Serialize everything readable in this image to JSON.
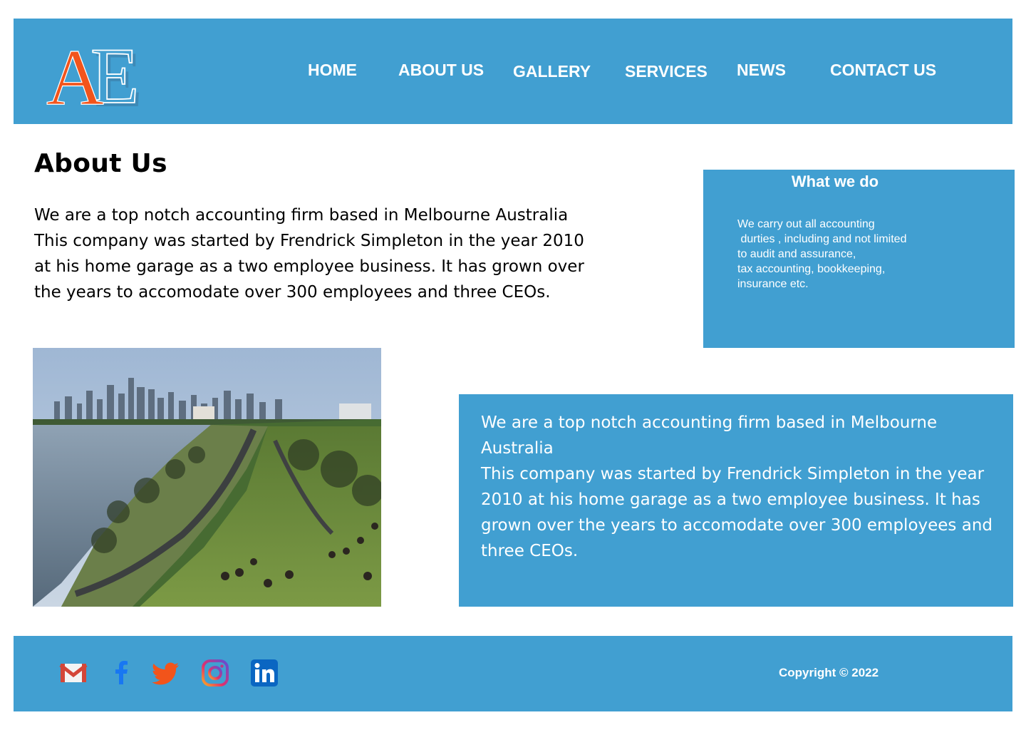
{
  "header": {
    "logo_text": "AE",
    "nav": [
      "HOME",
      "ABOUT US",
      "GALLERY",
      "SERVICES",
      "NEWS",
      "CONTACT US"
    ]
  },
  "about": {
    "title": "About Us",
    "paragraph_lines": [
      "We are a top notch accounting firm based in Melbourne Australia",
      "This company was started by Frendrick Simpleton in the year 2010 at his home garage as a two employee business. It has grown over the years to accomodate over 300 employees and three CEOs."
    ]
  },
  "what_we_do": {
    "title": "What we do",
    "lines": [
      "We carry out all accounting",
      " durties , including and not limited",
      "to audit and assurance,",
      "tax accounting, bookkeeping,",
      "insurance etc."
    ]
  },
  "feature_box": {
    "paragraph_lines": [
      "We are a top notch accounting firm based in Melbourne Australia",
      "This company was started by Frendrick Simpleton in the year 2010 at his home garage as a two employee business. It has grown over the years to accomodate over 300 employees and three CEOs."
    ]
  },
  "footer": {
    "social_icons": [
      "gmail-icon",
      "facebook-icon",
      "twitter-icon",
      "instagram-icon",
      "linkedin-icon"
    ],
    "copyright": "Copyright © 2022"
  },
  "colors": {
    "brand_blue": "#419fd1",
    "logo_orange": "#f2541b",
    "twitter_orange": "#f2541b",
    "facebook_blue": "#1877f2",
    "linkedin_blue": "#0a66c2"
  }
}
